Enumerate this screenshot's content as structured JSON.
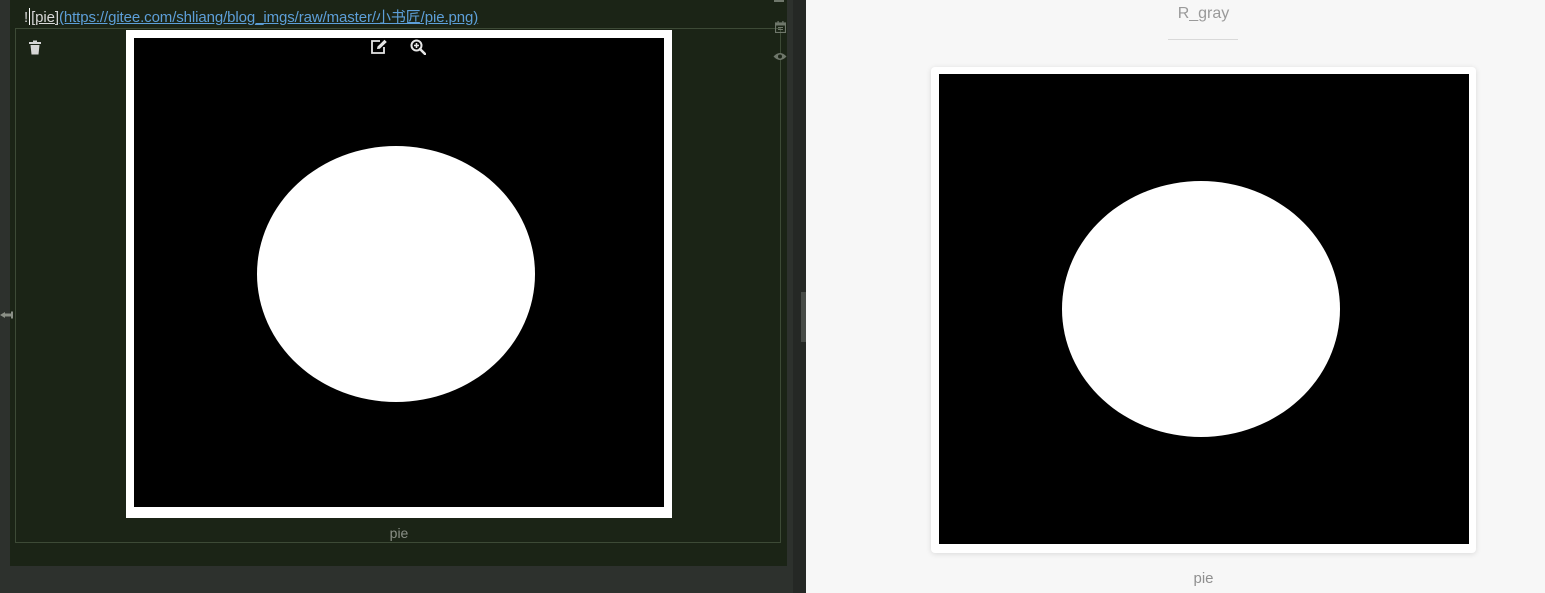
{
  "editor": {
    "markdown": {
      "bang": "!",
      "open_bracket": "[",
      "alt_text": "pie",
      "close_bracket": "]",
      "url": "(https://gitee.com/shliang/blog_imgs/raw/master/小书匠/pie.png)"
    },
    "image_caption": "pie",
    "icons": {
      "delete": "trash-icon",
      "edit": "edit-icon",
      "zoom": "zoom-in-icon",
      "calendar": "calendar-icon",
      "preview": "eye-icon",
      "pin": "pin-icon"
    }
  },
  "preview": {
    "title": "R_gray",
    "image_caption": "pie"
  },
  "colors": {
    "editor_bg": "#1b2416",
    "link": "#5d9fd8",
    "preview_bg": "#f7f7f7",
    "image_bg": "#000000",
    "ellipse": "#ffffff"
  }
}
